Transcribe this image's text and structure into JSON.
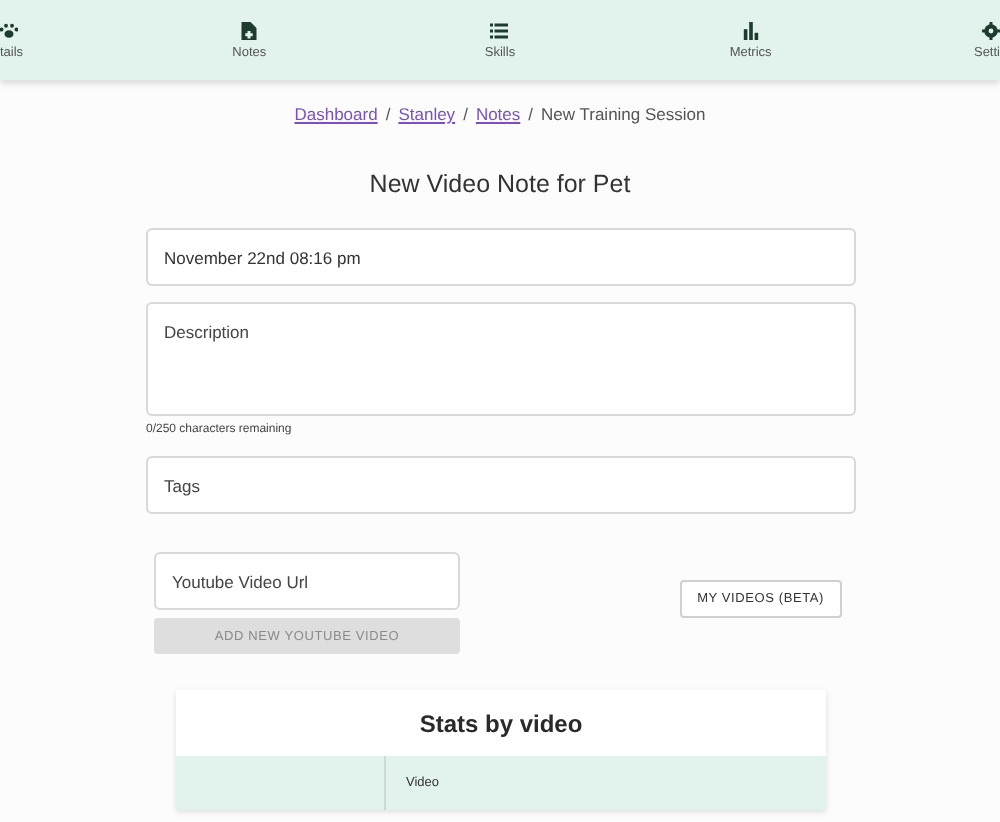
{
  "nav": {
    "items": [
      {
        "label": "tails",
        "kind": "paw"
      },
      {
        "label": "Notes",
        "kind": "note"
      },
      {
        "label": "Skills",
        "kind": "list"
      },
      {
        "label": "Metrics",
        "kind": "chart"
      },
      {
        "label": "Setti",
        "kind": "gear"
      }
    ]
  },
  "breadcrumb": {
    "separator": "/",
    "items": [
      {
        "label": "Dashboard",
        "link": true
      },
      {
        "label": "Stanley",
        "link": true
      },
      {
        "label": "Notes",
        "link": true
      },
      {
        "label": "New Training Session",
        "link": false
      }
    ]
  },
  "title": "New Video Note for Pet",
  "form": {
    "date": {
      "value": "November 22nd 08:16 pm"
    },
    "description": {
      "placeholder": "Description",
      "counter": "0/250 characters remaining"
    },
    "tags": {
      "placeholder": "Tags"
    },
    "youtube": {
      "placeholder": "Youtube Video Url"
    },
    "add_button": {
      "label": "ADD NEW YOUTUBE VIDEO",
      "disabled": true
    },
    "my_videos_button": {
      "label": "MY VIDEOS (BETA)",
      "disabled": false
    }
  },
  "stats": {
    "title": "Stats by video",
    "columns": [
      {
        "label": "Video"
      }
    ]
  }
}
